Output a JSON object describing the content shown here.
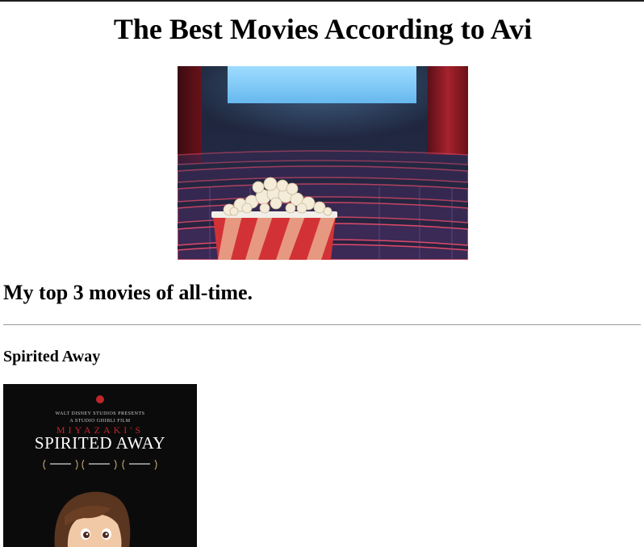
{
  "page": {
    "title": "The Best Movies According to Avi",
    "subtitle": "My top 3 movies of all-time."
  },
  "hero": {
    "icon": "cinema-popcorn-image"
  },
  "movies": [
    {
      "title": "Spirited Away",
      "poster": {
        "presenter_line": "WALT DISNEY STUDIOS PRESENTS",
        "studio_line": "A STUDIO GHIBLI FILM",
        "director": "MIYAZAKI'S",
        "film_title": "SPIRITED AWAY"
      }
    }
  ],
  "colors": {
    "poster_bg": "#0b0b0b",
    "poster_red": "#c0252b",
    "rule": "#9a9a9a"
  }
}
